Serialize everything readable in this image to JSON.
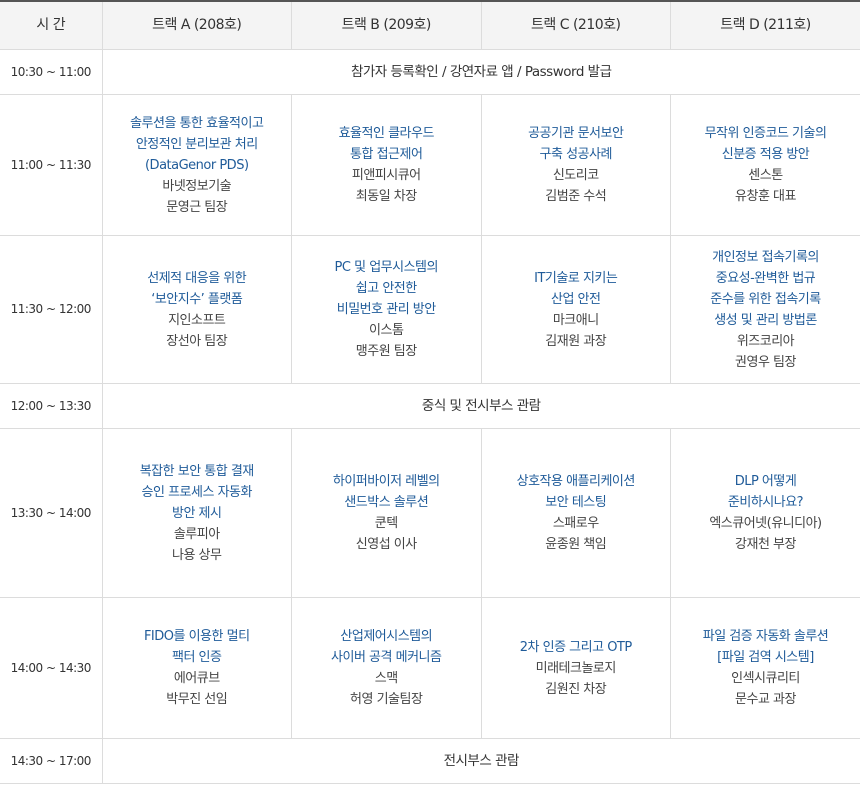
{
  "header": {
    "time": "시 간",
    "tracks": [
      "트랙 A (208호)",
      "트랙 B (209호)",
      "트랙 C (210호)",
      "트랙 D (211호)"
    ]
  },
  "rows": [
    {
      "time": "10:30 ~ 11:00",
      "text": "참가자 등록확인 / 강연자료 앱 / Password 발급"
    },
    {
      "time": "11:00 ~ 11:30",
      "sessions": [
        {
          "title": [
            "솔루션을 통한 효율적이고",
            "안정적인 분리보관 처리",
            "(DataGenor PDS)"
          ],
          "company": "바넷정보기술",
          "speaker": "문영근 팀장"
        },
        {
          "title": [
            "효율적인 클라우드",
            "통합 접근제어"
          ],
          "company": "피앤피시큐어",
          "speaker": "최동일 차장"
        },
        {
          "title": [
            "공공기관 문서보안",
            "구축 성공사례"
          ],
          "company": "신도리코",
          "speaker": "김범준 수석"
        },
        {
          "title": [
            "무작위 인증코드 기술의",
            "신분증 적용 방안"
          ],
          "company": "센스톤",
          "speaker": "유창훈 대표"
        }
      ]
    },
    {
      "time": "11:30 ~ 12:00",
      "sessions": [
        {
          "title": [
            "선제적 대응을 위한",
            "‘보안지수’ 플랫폼"
          ],
          "company": "지인소프트",
          "speaker": "장선아 팀장"
        },
        {
          "title": [
            "PC 및 업무시스템의",
            "쉽고 안전한",
            "비밀번호 관리 방안"
          ],
          "company": "이스톰",
          "speaker": "맹주원 팀장"
        },
        {
          "title": [
            "IT기술로 지키는",
            "산업 안전"
          ],
          "company": "마크애니",
          "speaker": "김재원 과장"
        },
        {
          "title": [
            "개인정보 접속기록의",
            "중요성-완벽한 법규",
            "준수를 위한 접속기록",
            "생성 및 관리 방법론"
          ],
          "company": "위즈코리아",
          "speaker": "권영우 팀장"
        }
      ]
    },
    {
      "time": "12:00 ~ 13:30",
      "text": "중식 및 전시부스 관람"
    },
    {
      "time": "13:30 ~ 14:00",
      "sessions": [
        {
          "title": [
            "복잡한 보안 통합 결재",
            "승인 프로세스 자동화",
            "방안 제시"
          ],
          "company": "솔루피아",
          "speaker": "나용 상무"
        },
        {
          "title": [
            "하이퍼바이저 레벨의",
            "샌드박스 솔루션"
          ],
          "company": "쿤텍",
          "speaker": "신영섭 이사"
        },
        {
          "title": [
            "상호작용 애플리케이션",
            "보안 테스팅"
          ],
          "company": "스패로우",
          "speaker": "윤종원 책임"
        },
        {
          "title": [
            "DLP 어떻게",
            "준비하시나요?"
          ],
          "company": "엑스큐어넷(유니디아)",
          "speaker": "강재천 부장"
        }
      ]
    },
    {
      "time": "14:00 ~ 14:30",
      "sessions": [
        {
          "title": [
            "FIDO를 이용한 멀티",
            "팩터 인증"
          ],
          "company": "에어큐브",
          "speaker": "박무진 선임"
        },
        {
          "title": [
            "산업제어시스템의",
            "사이버 공격 메커니즘"
          ],
          "company": "스맥",
          "speaker": "허영 기술팀장"
        },
        {
          "title": [
            "2차 인증 그리고 OTP"
          ],
          "company": "미래테크놀로지",
          "speaker": "김원진 차장"
        },
        {
          "title": [
            "파일 검증 자동화 솔루션",
            "[파일 검역 시스템]"
          ],
          "company": "인섹시큐리티",
          "speaker": "문수교 과장"
        }
      ]
    },
    {
      "time": "14:30 ~ 17:00",
      "text": "전시부스 관람"
    }
  ]
}
